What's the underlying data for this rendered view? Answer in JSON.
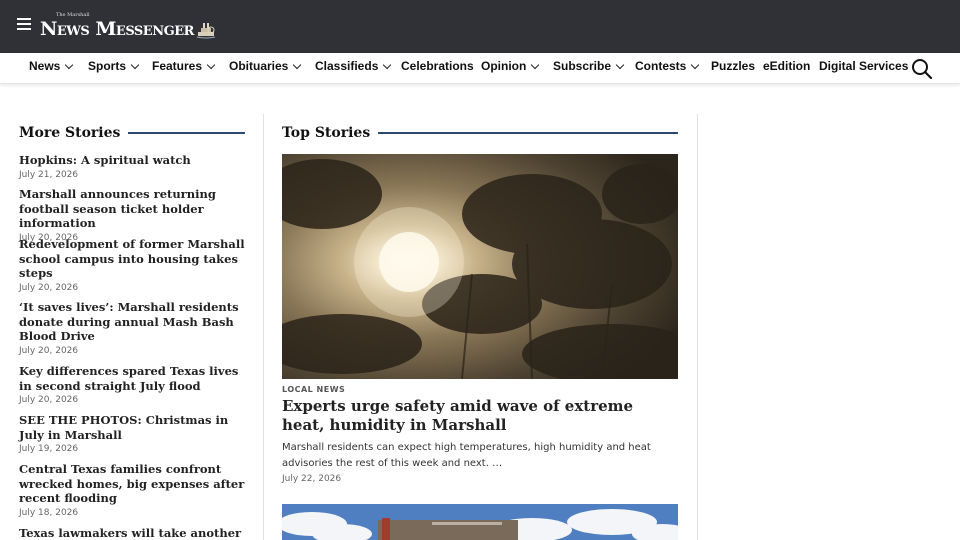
{
  "header": {
    "logo_small": "The Marshall",
    "logo_text": "News Messenger",
    "menu_icon": "hamburger-menu-icon",
    "background": "#2f3136"
  },
  "nav": {
    "items": [
      {
        "label": "News",
        "dropdown": true
      },
      {
        "label": "Sports",
        "dropdown": true
      },
      {
        "label": "Features",
        "dropdown": true
      },
      {
        "label": "Obituaries",
        "dropdown": true
      },
      {
        "label": "Classifieds",
        "dropdown": true
      },
      {
        "label": "Celebrations",
        "dropdown": false
      },
      {
        "label": "Opinion",
        "dropdown": true
      },
      {
        "label": "Subscribe",
        "dropdown": true
      },
      {
        "label": "Contests",
        "dropdown": true
      },
      {
        "label": "Puzzles",
        "dropdown": false
      },
      {
        "label": "eEdition",
        "dropdown": false
      },
      {
        "label": "Digital Services",
        "dropdown": false
      }
    ],
    "search_icon": "search-icon"
  },
  "more_stories": {
    "title": "More Stories",
    "items": [
      {
        "title": "Hopkins: A spiritual watch",
        "date": "July 21, 2026"
      },
      {
        "title": "Marshall announces returning football season ticket holder information",
        "date": "July 20, 2026"
      },
      {
        "title": "Redevelopment of former Marshall school campus into housing takes steps",
        "date": "July 20, 2026"
      },
      {
        "title": "‘It saves lives’: Marshall residents donate during annual Mash Bash Blood Drive",
        "date": "July 20, 2026"
      },
      {
        "title": "Key differences spared Texas lives in second straight July flood",
        "date": "July 20, 2026"
      },
      {
        "title": "SEE THE PHOTOS: Christmas in July in Marshall",
        "date": "July 19, 2026"
      },
      {
        "title": "Central Texas families confront wrecked homes, big expenses after recent flooding",
        "date": "July 18, 2026"
      },
      {
        "title": "Texas lawmakers will take another",
        "date": ""
      }
    ]
  },
  "top_stories": {
    "title": "Top Stories",
    "lead": {
      "category": "LOCAL NEWS",
      "headline": "Experts urge safety amid wave of extreme heat, humidity in Marshall",
      "summary": "Marshall residents can expect high temperatures, high humidity and heat advisories the rest of this week and next. …",
      "date": "July 22, 2026"
    }
  },
  "colors": {
    "accent_rule": "#2c4a6e",
    "divider": "#e2e2e2"
  }
}
